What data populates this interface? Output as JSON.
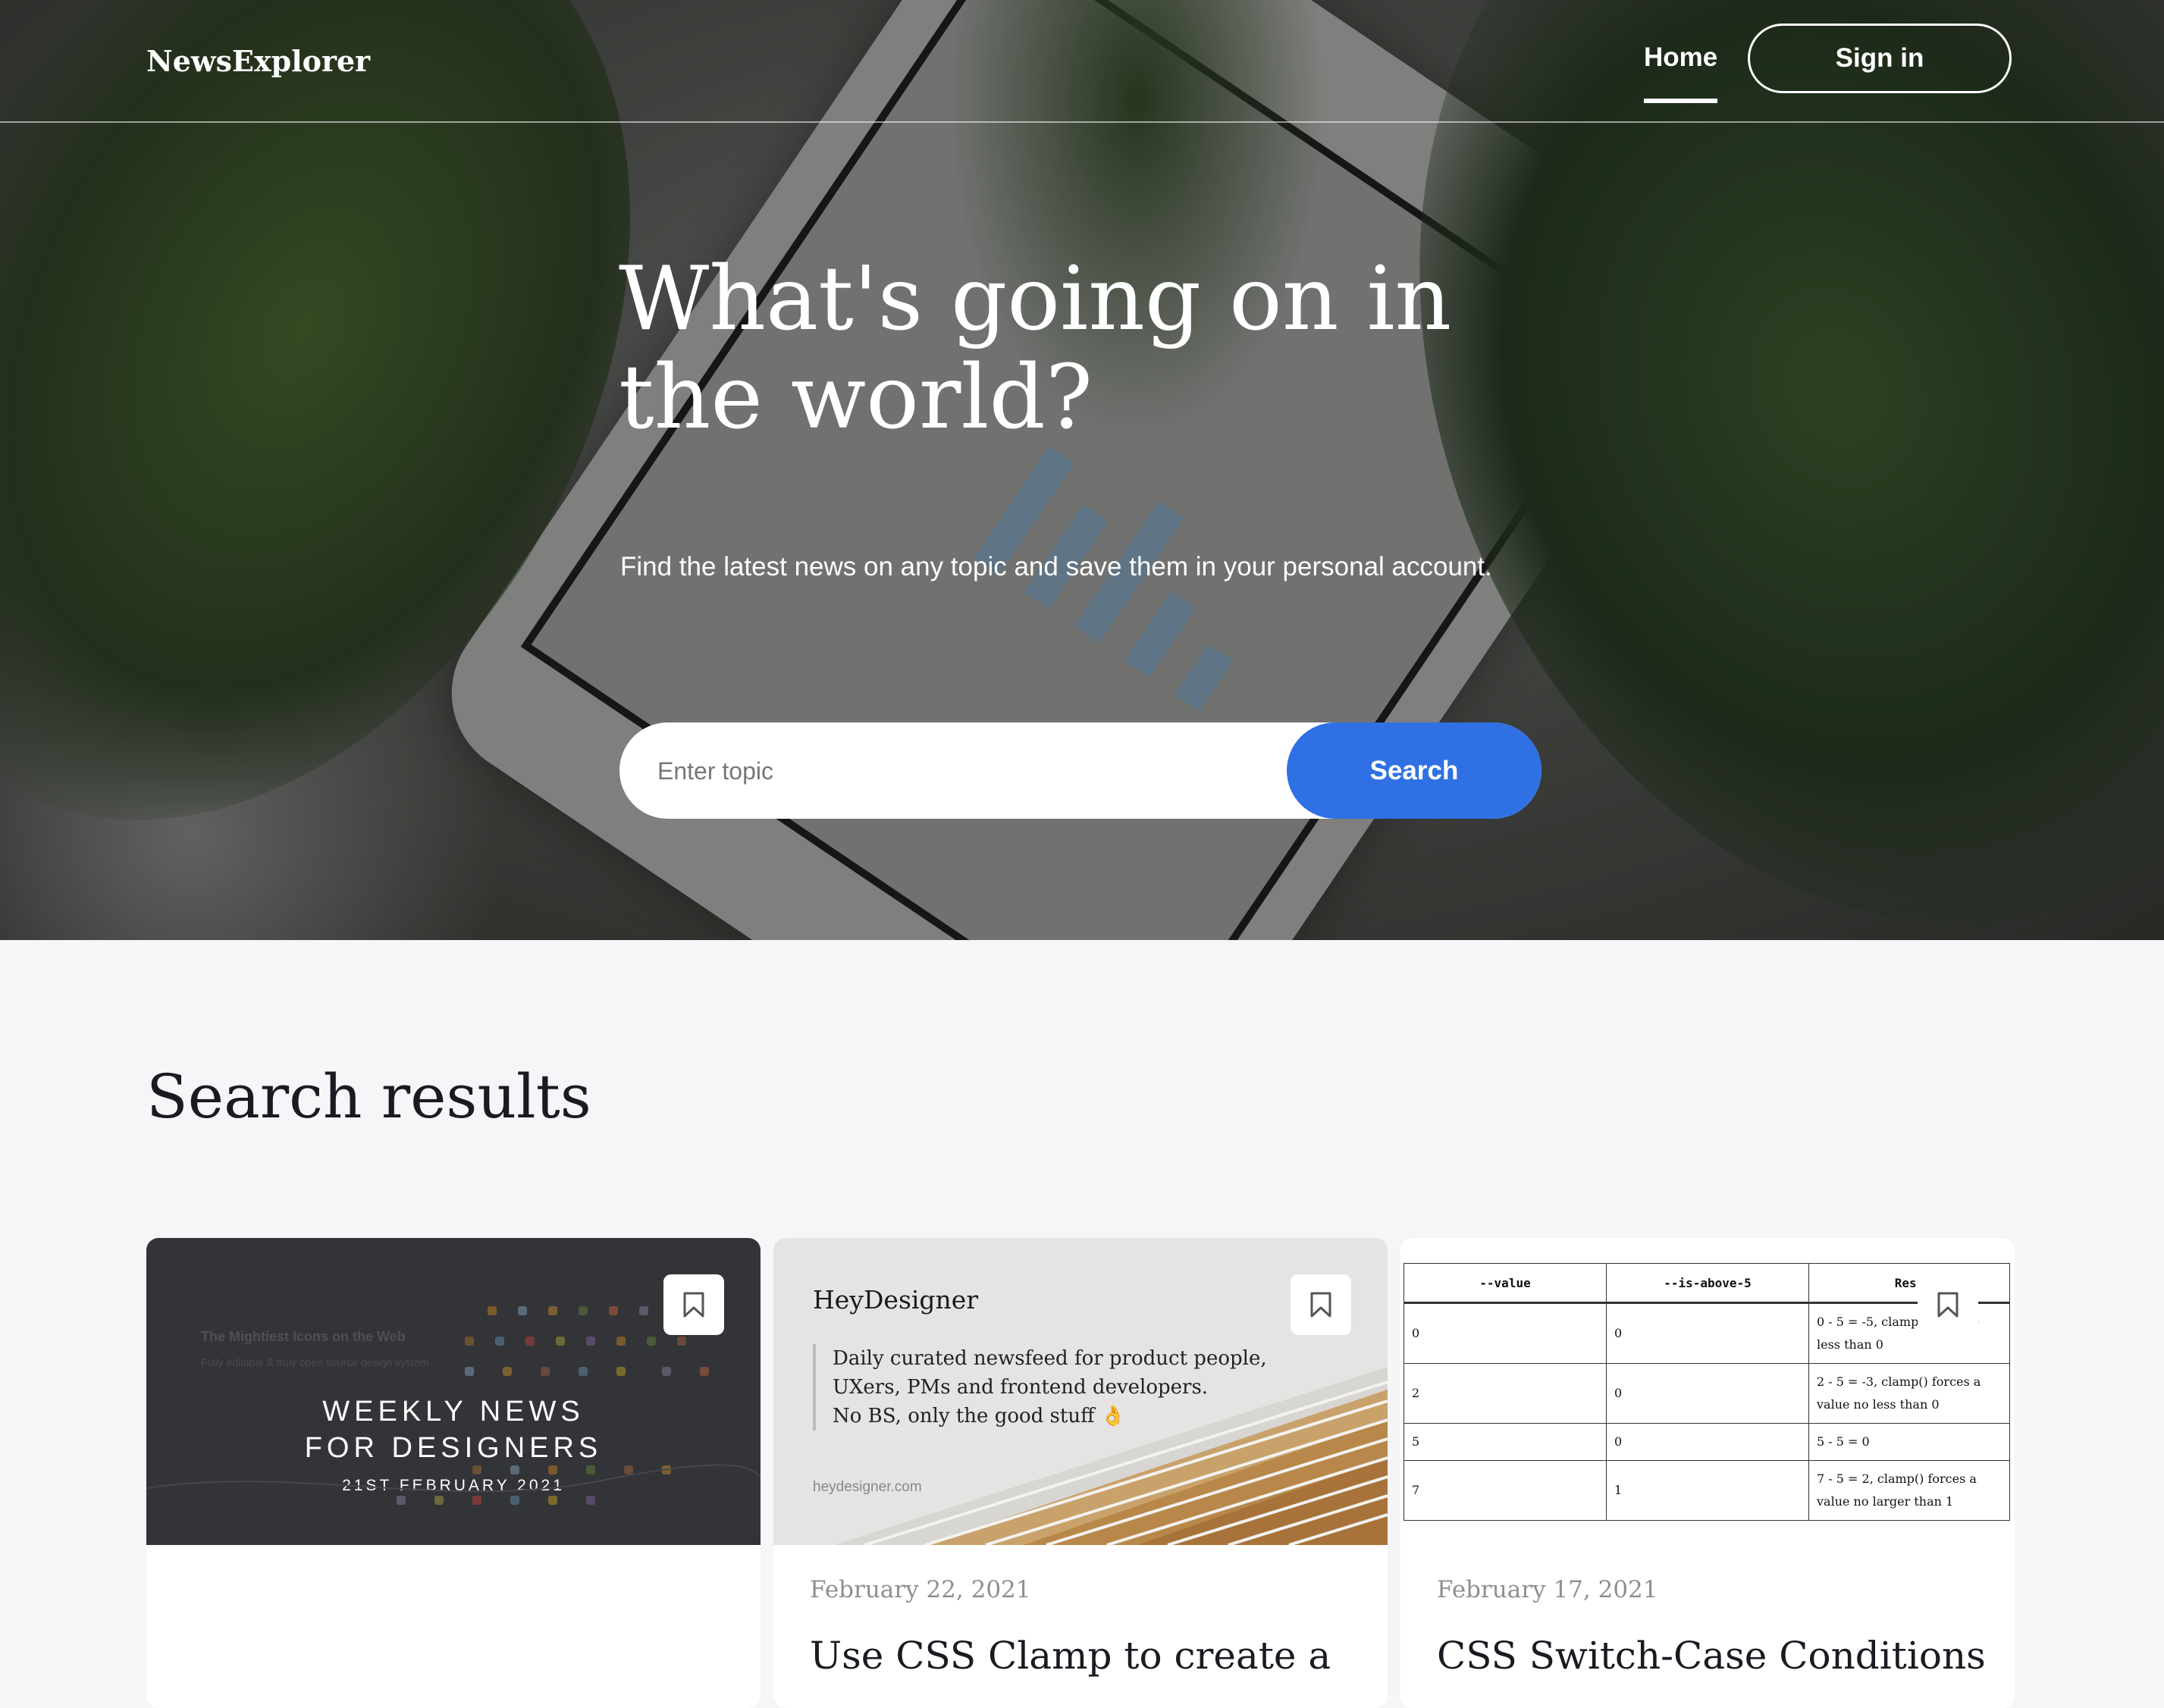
{
  "header": {
    "logo": "NewsExplorer",
    "nav_home": "Home",
    "signin_label": "Sign in"
  },
  "hero": {
    "title": "What's going on in the world?",
    "subtitle": "Find the latest news on any topic and save them in your personal account.",
    "search_placeholder": "Enter topic",
    "search_button": "Search"
  },
  "results": {
    "title": "Search results",
    "cards": [
      {
        "image": {
          "line1": "WEEKLY NEWS",
          "line2": "FOR DESIGNERS",
          "line3": "21ST FEBRUARY 2021",
          "faint_heading": "The Mightiest Icons on the Web",
          "faint_sub": "Fully editable & truly open source design system"
        },
        "bookmark_icon": "bookmark-icon"
      },
      {
        "image": {
          "brand": "HeyDesigner",
          "quote_lines": [
            "Daily curated newsfeed for product people,",
            "UXers, PMs and frontend developers.",
            "No BS, only the good stuff 👌"
          ],
          "url": "heydesigner.com"
        },
        "date": "February 22, 2021",
        "title": "Use CSS Clamp to create a",
        "bookmark_icon": "bookmark-icon"
      },
      {
        "image": {
          "headers": [
            "--value",
            "--is-above-5",
            "Resu"
          ],
          "rows": [
            [
              "0",
              "0",
              "0 - 5 = -5, clamp( value no less than 0"
            ],
            [
              "2",
              "0",
              "2 - 5 = -3, clamp() forces a value no less than 0"
            ],
            [
              "5",
              "0",
              "5 - 5 = 0"
            ],
            [
              "7",
              "1",
              "7 - 5 = 2, clamp() forces a value no larger than 1"
            ]
          ]
        },
        "date": "February 17, 2021",
        "title": "CSS Switch-Case Conditions",
        "bookmark_icon": "bookmark-icon"
      }
    ]
  },
  "colors": {
    "accent": "#2f71e5",
    "text_dark": "#1a1b22",
    "page_bg": "#f5f6f7"
  }
}
